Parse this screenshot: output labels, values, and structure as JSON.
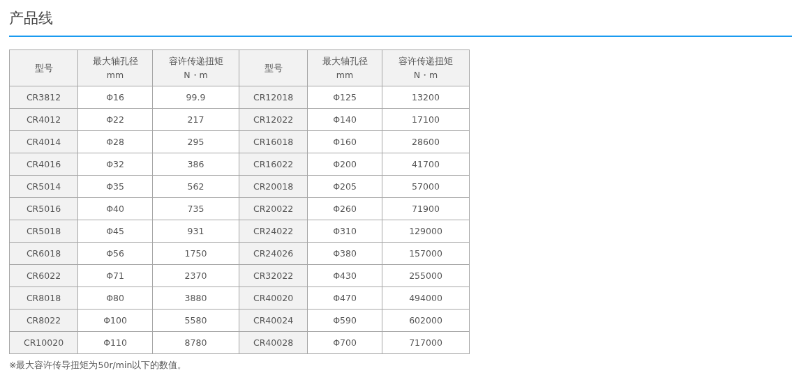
{
  "title": "产品线",
  "table": {
    "columns": [
      {
        "label": "型号"
      },
      {
        "label": "最大轴孔径",
        "unit": "mm"
      },
      {
        "label": "容许传递扭矩",
        "unit": "N・m"
      },
      {
        "label": "型号"
      },
      {
        "label": "最大轴孔径",
        "unit": "mm"
      },
      {
        "label": "容许传递扭矩",
        "unit": "N・m"
      }
    ],
    "rows": [
      [
        "CR3812",
        "Φ16",
        "99.9",
        "CR12018",
        "Φ125",
        "13200"
      ],
      [
        "CR4012",
        "Φ22",
        "217",
        "CR12022",
        "Φ140",
        "17100"
      ],
      [
        "CR4014",
        "Φ28",
        "295",
        "CR16018",
        "Φ160",
        "28600"
      ],
      [
        "CR4016",
        "Φ32",
        "386",
        "CR16022",
        "Φ200",
        "41700"
      ],
      [
        "CR5014",
        "Φ35",
        "562",
        "CR20018",
        "Φ205",
        "57000"
      ],
      [
        "CR5016",
        "Φ40",
        "735",
        "CR20022",
        "Φ260",
        "71900"
      ],
      [
        "CR5018",
        "Φ45",
        "931",
        "CR24022",
        "Φ310",
        "129000"
      ],
      [
        "CR6018",
        "Φ56",
        "1750",
        "CR24026",
        "Φ380",
        "157000"
      ],
      [
        "CR6022",
        "Φ71",
        "2370",
        "CR32022",
        "Φ430",
        "255000"
      ],
      [
        "CR8018",
        "Φ80",
        "3880",
        "CR40020",
        "Φ470",
        "494000"
      ],
      [
        "CR8022",
        "Φ100",
        "5580",
        "CR40024",
        "Φ590",
        "602000"
      ],
      [
        "CR10020",
        "Φ110",
        "8780",
        "CR40028",
        "Φ700",
        "717000"
      ]
    ]
  },
  "footnote": "※最大容许传导扭矩为50r/min以下的数值。"
}
